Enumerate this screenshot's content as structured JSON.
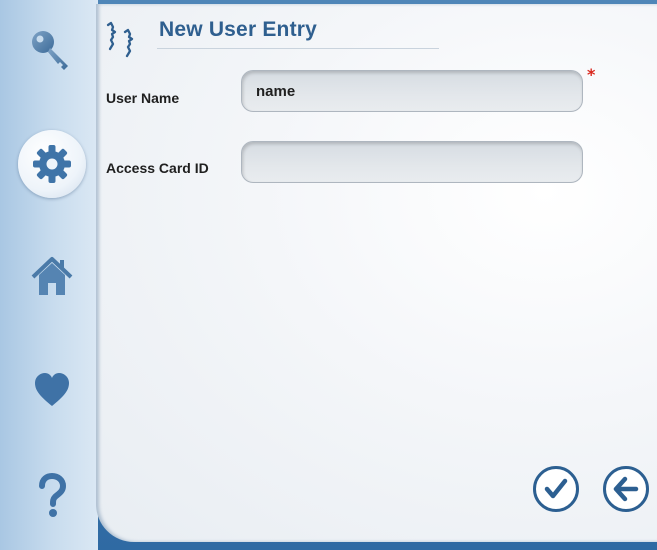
{
  "page": {
    "title": "New User Entry"
  },
  "sidebar": {
    "items": [
      {
        "icon": "key-icon"
      },
      {
        "icon": "gear-icon",
        "active": true
      },
      {
        "icon": "home-icon"
      },
      {
        "icon": "heart-icon"
      },
      {
        "icon": "help-icon"
      }
    ]
  },
  "form": {
    "user_name": {
      "label": "User Name",
      "value": "name",
      "required_mark": "*"
    },
    "access_card": {
      "label": "Access Card ID",
      "value": ""
    }
  },
  "actions": {
    "confirm_icon": "checkmark-icon",
    "back_icon": "back-arrow-icon"
  },
  "colors": {
    "accent": "#2f5f8f",
    "required": "#d9261c",
    "frame": "#2f6aa3"
  }
}
